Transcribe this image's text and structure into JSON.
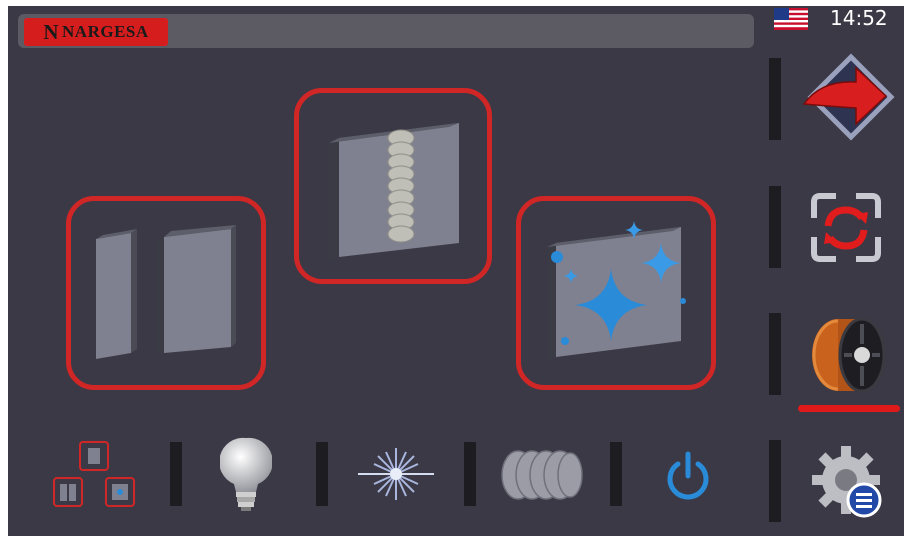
{
  "header": {
    "brand": "NARGESA",
    "brand_mark": "N",
    "time": "14:52",
    "language_flag": "us-flag-icon"
  },
  "modes": [
    {
      "name": "two-plates-mode",
      "selected": true
    },
    {
      "name": "weld-seam-mode",
      "selected": true
    },
    {
      "name": "cleaning-mode",
      "selected": true
    }
  ],
  "side_menu": [
    {
      "icon": "next-arrow-icon"
    },
    {
      "icon": "refresh-scan-icon"
    },
    {
      "icon": "wire-spool-icon",
      "active": true
    },
    {
      "icon": "settings-gear-icon"
    }
  ],
  "bottom_bar": [
    {
      "icon": "mode-selector-icon"
    },
    {
      "icon": "light-bulb-icon"
    },
    {
      "icon": "laser-burst-icon"
    },
    {
      "icon": "weld-beads-icon"
    },
    {
      "icon": "power-icon"
    }
  ],
  "colors": {
    "background": "#3b3946",
    "accent_red": "#d12626",
    "accent_blue": "#2a8bd8"
  }
}
